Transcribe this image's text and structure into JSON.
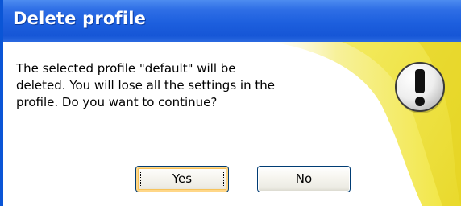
{
  "dialog": {
    "title": "Delete profile",
    "message": "The selected profile \"default\" will be\ndeleted. You will lose all the settings in the\nprofile. Do you want to continue?",
    "icon": "exclamation-warning-icon",
    "buttons": {
      "yes": "Yes",
      "no": "No"
    }
  },
  "colors": {
    "titlebar": "#1d5fde",
    "accent_yellow": "#f2e640",
    "frame_blue": "#0a55d6"
  }
}
